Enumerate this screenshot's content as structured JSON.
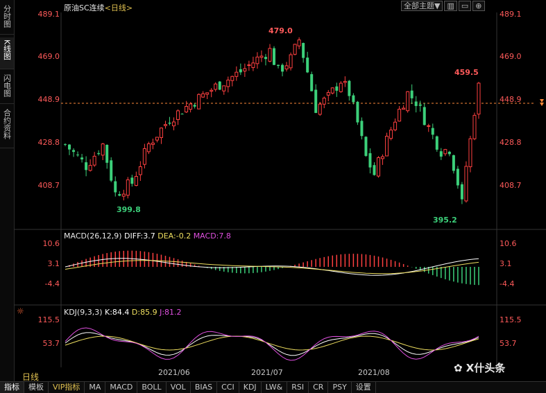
{
  "sidebar": {
    "tabs": [
      {
        "label": "分时图"
      },
      {
        "label": "K线图"
      },
      {
        "label": "闪电图"
      },
      {
        "label": "合约资料"
      }
    ]
  },
  "header": {
    "instrument": "原油SC连续",
    "period": "<日线>",
    "theme_select": "全部主题▼",
    "btn1": "▥",
    "btn2": "▭",
    "btn3": "⊕"
  },
  "price_axis": {
    "ticks": [
      "489.1",
      "469.0",
      "448.9",
      "428.8",
      "408.7"
    ],
    "current_price_label": "448.9"
  },
  "price_annotations": {
    "high": "479.0",
    "low1": "399.8",
    "low2": "395.2",
    "recent_high": "459.5"
  },
  "macd": {
    "title": "MACD(26,12,9)",
    "diff": "DIFF:3.7",
    "dea": "DEA:-0.2",
    "macd": "MACD:7.8",
    "ticks": [
      "10.6",
      "3.1",
      "-4.4"
    ]
  },
  "kdj": {
    "title": "KDJ(9,3,3)",
    "k": "K:84.4",
    "d": "D:85.9",
    "j": "J:81.2",
    "ticks": [
      "115.5",
      "53.7"
    ]
  },
  "x_axis": {
    "dates": [
      "2021/06",
      "2021/07",
      "2021/08"
    ]
  },
  "period_label": "日线",
  "watermark": "X什头条",
  "bottom_tabs": [
    "指标",
    "模板",
    "VIP指标",
    "MA",
    "MACD",
    "BOLL",
    "VOL",
    "BIAS",
    "CCI",
    "KDJ",
    "LW&",
    "RSI",
    "CR",
    "PSY",
    "设置"
  ],
  "colors": {
    "up": "#ff4040",
    "down": "#3cd07a",
    "dif": "#ffffff",
    "dea": "#f0e060",
    "macd_label": "#e050e0",
    "kdj_j": "#e050e0",
    "axis_text": "#ff5a5a"
  }
}
